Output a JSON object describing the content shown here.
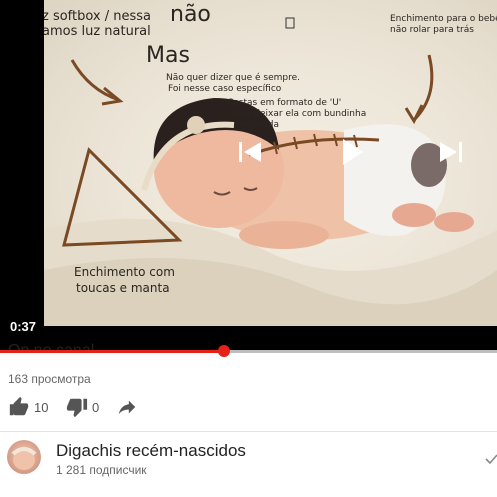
{
  "player": {
    "timestamp": "0:37",
    "progress_fraction": 0.45,
    "controls": {
      "previous_icon": "skip-previous-icon",
      "play_icon": "play-icon",
      "next_icon": "skip-next-icon"
    },
    "annotations": {
      "softbox_line": "z softbox / nessa",
      "nao": "não",
      "luz_line": "amos luz natural",
      "mas": "Mas",
      "nao_quer_line1": "Não quer dizer que é sempre.",
      "nao_quer_line2": "Foi nesse caso específico",
      "costas_line1": "Costas em formato de 'U'",
      "costas_line2": "para deixar ela com bundinha",
      "costas_line3": "empinada",
      "enchimento_top_line1": "Enchimento para o bebê",
      "enchimento_top_line2": "não rolar para trás",
      "enchimento_bottom_line1": "Enchimento com",
      "enchimento_bottom_line2": "toucas e manta"
    }
  },
  "video": {
    "title_partial": "Op no canal",
    "views": "163 просмотра",
    "likes": "10",
    "dislikes": "0",
    "like_icon": "thumb-up-icon",
    "dislike_icon": "thumb-down-icon",
    "share_icon": "share-icon"
  },
  "channel": {
    "name": "Digachis recém-nascidos",
    "subscribers": "1 281 подписчик",
    "subscribed_icon": "check-icon"
  },
  "colors": {
    "progress": "#e62117",
    "annotation_brown": "#7a4a24"
  }
}
